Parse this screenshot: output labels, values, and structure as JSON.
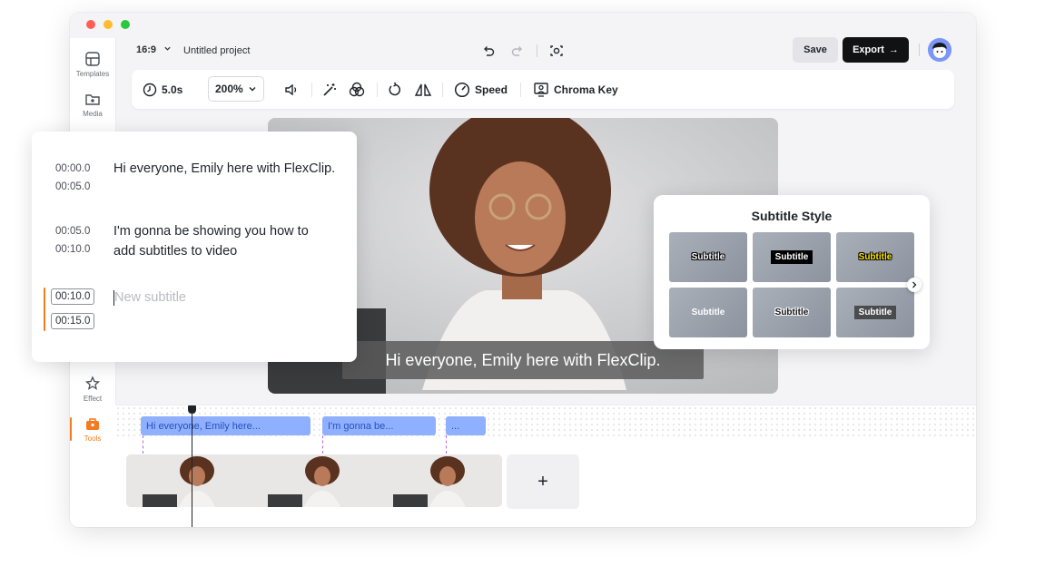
{
  "window": {
    "traffic_lights": [
      "#ff5f57",
      "#febc2e",
      "#28c840"
    ]
  },
  "sidebar": {
    "items": [
      {
        "label": "Templates",
        "icon": "templates-icon"
      },
      {
        "label": "Media",
        "icon": "media-icon"
      },
      {
        "label": "Effect",
        "icon": "effect-icon"
      },
      {
        "label": "Tools",
        "icon": "tools-icon",
        "active": true
      }
    ]
  },
  "header": {
    "aspect_ratio": "16:9",
    "project_title": "Untitled project",
    "save_label": "Save",
    "export_label": "Export",
    "export_arrow": "→"
  },
  "toolbar": {
    "duration": "5.0s",
    "zoom": "200%",
    "speed_label": "Speed",
    "chroma_label": "Chroma Key"
  },
  "preview": {
    "subtitle_overlay": "Hi everyone, Emily here with FlexClip."
  },
  "subtitles": [
    {
      "start": "00:00.0",
      "end": "00:05.0",
      "text_line1": "Hi everyone, Emily here with FlexClip.",
      "text_line2": ""
    },
    {
      "start": "00:05.0",
      "end": "00:10.0",
      "text_line1": "I'm gonna be showing you how to",
      "text_line2": "add subtitles to video"
    },
    {
      "start": "00:10.0",
      "end": "00:15.0",
      "placeholder": "New subtitle"
    }
  ],
  "subtitle_style": {
    "title": "Subtitle Style",
    "sample": "Subtitle"
  },
  "timeline": {
    "chips": [
      "Hi everyone, Emily here...",
      "I'm gonna be...",
      "..."
    ],
    "add_clip": "+"
  },
  "colors": {
    "accent": "#f47b20",
    "chip": "#8fb0ff",
    "export_bg": "#111214"
  }
}
